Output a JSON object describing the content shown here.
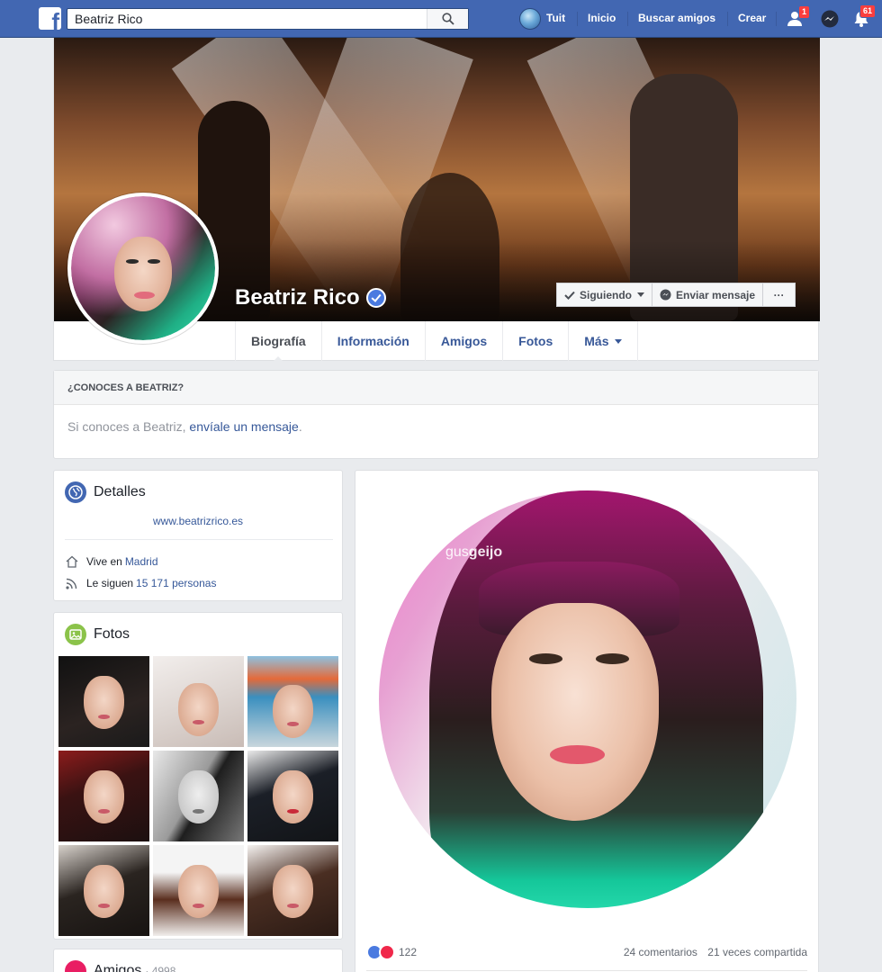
{
  "topbar": {
    "search_value": "Beatriz Rico",
    "user_name": "Tuit",
    "nav": [
      "Inicio",
      "Buscar amigos",
      "Crear"
    ],
    "badges": {
      "friend_requests": "1",
      "notifications": "61"
    }
  },
  "profile": {
    "name": "Beatriz Rico",
    "actions": {
      "following": "Siguiendo",
      "message": "Enviar mensaje",
      "more": "···"
    },
    "tabs": [
      "Biografía",
      "Información",
      "Amigos",
      "Fotos",
      "Más"
    ]
  },
  "know_box": {
    "title": "¿CONOCES A BEATRIZ?",
    "text_prefix": "Si conoces a Beatriz, ",
    "link": "envíale un mensaje",
    "suffix": "."
  },
  "details": {
    "title": "Detalles",
    "website": "www.beatrizrico.es",
    "lives_prefix": "Vive en",
    "lives_city": "Madrid",
    "followers_prefix": "Le siguen",
    "followers_count": "15 171 personas"
  },
  "photos": {
    "title": "Fotos",
    "count_shown": 9
  },
  "friends": {
    "title": "Amigos",
    "count": "· 4998"
  },
  "post": {
    "watermark_prefix": "gus",
    "watermark_name": "geijo",
    "reactions": "122",
    "comments": "24 comentarios",
    "shares": "21 veces compartida"
  },
  "colors": {
    "brand": "#4267b2",
    "link": "#365899",
    "badge": "#fa3e3e"
  }
}
